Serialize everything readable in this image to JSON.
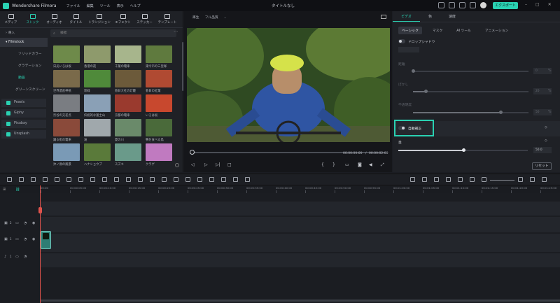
{
  "app": {
    "name": "Wondershare Filmora",
    "doc_title": "タイトルなし",
    "export_label": "エクスポート"
  },
  "menu": [
    "ファイル",
    "編集",
    "ツール",
    "表示",
    "ヘルプ"
  ],
  "media_tabs": [
    {
      "label": "メディア",
      "icon": "media-icon"
    },
    {
      "label": "ストック",
      "icon": "stock-icon",
      "active": true
    },
    {
      "label": "オーディオ",
      "icon": "music-icon"
    },
    {
      "label": "タイトル",
      "icon": "title-icon"
    },
    {
      "label": "トランジション",
      "icon": "transition-icon"
    },
    {
      "label": "エフェクト",
      "icon": "effect-icon"
    },
    {
      "label": "ステッカー",
      "icon": "sticker-icon"
    },
    {
      "label": "テンプレート",
      "icon": "template-icon"
    }
  ],
  "tree": {
    "import": "導入",
    "filmstock": "Filmstock",
    "items": [
      "ソリッドカラー",
      "グラデーション",
      "動画",
      "グリーンスクリーン"
    ],
    "active_item": "動画",
    "providers": [
      "Pexels",
      "Giphy",
      "Pixabay",
      "Unsplash"
    ]
  },
  "search": {
    "placeholder": "検索"
  },
  "thumbnails": [
    {
      "label": "日光いろは坂",
      "color": "#6e8a4a"
    },
    {
      "label": "香港の夜",
      "color": "#8e9a6c"
    },
    {
      "label": "千葉の電車",
      "color": "#a7b58c"
    },
    {
      "label": "東今市の三里塚",
      "color": "#5f7a3e"
    },
    {
      "label": "世界遺産神祇",
      "color": "#7a6a4a"
    },
    {
      "label": "新緑",
      "color": "#4f8a3a"
    },
    {
      "label": "春日大社の灯籠",
      "color": "#6c5a3a"
    },
    {
      "label": "春日の紅葉",
      "color": "#b04a32"
    },
    {
      "label": "渋谷の交差点",
      "color": "#7a7d82"
    },
    {
      "label": "伝統的な富士山",
      "color": "#8aa0b6"
    },
    {
      "label": "京都の電車",
      "color": "#9a3a2e"
    },
    {
      "label": "いろは坂",
      "color": "#c8482e"
    },
    {
      "label": "踊る街の電車",
      "color": "#8a4a3a"
    },
    {
      "label": "滝",
      "color": "#a0a8ac"
    },
    {
      "label": "夏の川",
      "color": "#6a8a6a"
    },
    {
      "label": "鴨を食べる鳥",
      "color": "#4a6a3a"
    },
    {
      "label": "沖ノ鳥の風景",
      "color": "#7a9ab6"
    },
    {
      "label": "ハナショウブ",
      "color": "#5a7a3a"
    },
    {
      "label": "スズキ",
      "color": "#6a9a8a"
    },
    {
      "label": "クラゲ",
      "color": "#c07ac0"
    }
  ],
  "preview": {
    "tab_play": "再生",
    "quality": "フル品質",
    "current_time": "00:00:00:00",
    "separator": "/",
    "total_time": "00:00:02:00"
  },
  "right_panel": {
    "tabs": [
      "ビデオ",
      "色",
      "速度"
    ],
    "subtabs": [
      "ベーシック",
      "マスク",
      "AI ツール",
      "アニメーション"
    ],
    "dropshadow_label": "ドロップシャドウ",
    "params": [
      {
        "label": "距離",
        "value": "0",
        "unit": "%"
      },
      {
        "label": "ぼかし",
        "value": "20",
        "unit": "%"
      },
      {
        "label": "不透明度",
        "value": "50",
        "unit": "%"
      }
    ],
    "auto_correct_label": "自動補正",
    "amount_label": "量",
    "amount_value": "50.0",
    "amount_fraction": 0.5,
    "reset_label": "リセット"
  },
  "timeline": {
    "ruler": [
      "00:00",
      "00:00:05:00",
      "00:00:10:00",
      "00:00:15:00",
      "00:00:20:00",
      "00:00:25:00",
      "00:00:30:00",
      "00:00:35:00",
      "00:00:40:00",
      "00:00:45:00",
      "00:00:50:00",
      "00:00:55:00",
      "00:01:00:00",
      "00:01:05:00",
      "00:01:10:00",
      "00:01:15:00",
      "00:01:20:00",
      "00:01:25:00"
    ],
    "tracks": [
      {
        "num": "2",
        "icon": "video-track-icon"
      },
      {
        "num": "1",
        "icon": "video-track-icon"
      },
      {
        "num": "1",
        "icon": "audio-track-icon"
      }
    ]
  }
}
